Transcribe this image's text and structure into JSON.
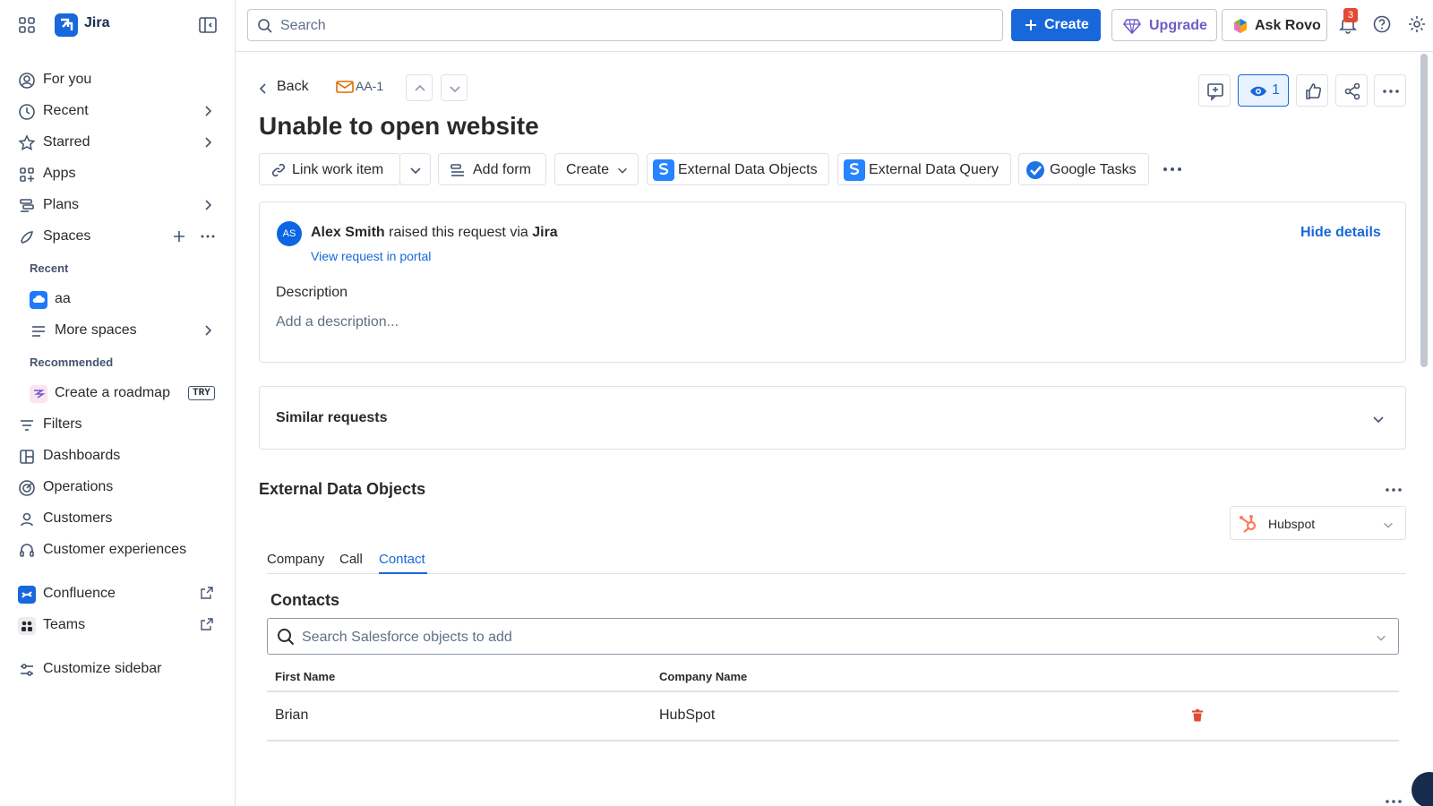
{
  "app": {
    "name": "Jira"
  },
  "topbar": {
    "search_placeholder": "Search",
    "create_label": "Create",
    "upgrade_label": "Upgrade",
    "rovo_label": "Ask Rovo",
    "notifications_count": "3"
  },
  "sidebar": {
    "items": [
      {
        "label": "For you"
      },
      {
        "label": "Recent"
      },
      {
        "label": "Starred"
      },
      {
        "label": "Apps"
      },
      {
        "label": "Plans"
      },
      {
        "label": "Spaces"
      }
    ],
    "recent_section": "Recent",
    "recent_space": "aa",
    "more_spaces": "More spaces",
    "recommended_section": "Recommended",
    "roadmap_label": "Create a roadmap",
    "try_badge": "TRY",
    "lower_items": [
      {
        "label": "Filters"
      },
      {
        "label": "Dashboards"
      },
      {
        "label": "Operations"
      },
      {
        "label": "Customers"
      },
      {
        "label": "Customer experiences"
      }
    ],
    "confluence_label": "Confluence",
    "teams_label": "Teams",
    "customize_label": "Customize sidebar"
  },
  "issue": {
    "back_label": "Back",
    "key": "AA-1",
    "title": "Unable to open website",
    "watchers": "1",
    "toolbar": {
      "link_label": "Link work item",
      "add_form_label": "Add form",
      "create_label": "Create",
      "ext_objects_label": "External Data Objects",
      "ext_query_label": "External Data Query",
      "google_tasks_label": "Google Tasks"
    },
    "request": {
      "avatar_initials": "AS",
      "reporter": "Alex Smith",
      "raised_text": "raised this request via",
      "channel": "Jira",
      "portal_link": "View request in portal",
      "hide_details": "Hide details"
    },
    "description_label": "Description",
    "description_placeholder": "Add a description...",
    "similar_label": "Similar requests"
  },
  "external": {
    "title": "External Data Objects",
    "provider": "Hubspot",
    "tabs": [
      {
        "label": "Company"
      },
      {
        "label": "Call"
      },
      {
        "label": "Contact"
      }
    ],
    "active_tab": "Contact",
    "section_title": "Contacts",
    "search_placeholder": "Search Salesforce objects to add",
    "columns": [
      "First Name",
      "Company Name"
    ],
    "rows": [
      {
        "first_name": "Brian",
        "company": "HubSpot"
      }
    ]
  },
  "colors": {
    "accent": "#1868db",
    "upgrade": "#6e5dc6",
    "danger": "#e34935",
    "hubspot": "#ff7a59"
  }
}
